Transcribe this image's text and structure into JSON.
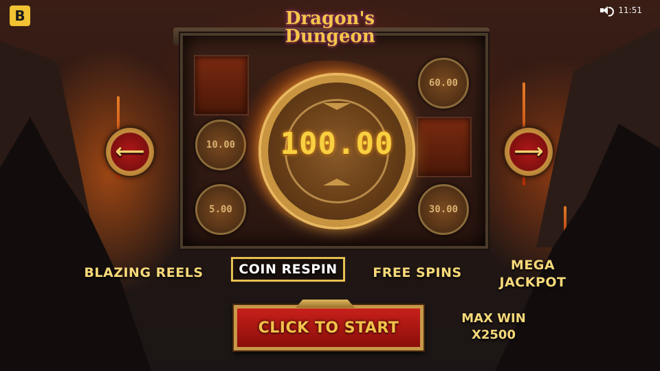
{
  "brand": {
    "logo_letter": "B"
  },
  "status_bar": {
    "time": "11:51",
    "sound_icon": "speaker-icon"
  },
  "game": {
    "title_line1": "Dragon's",
    "title_line2": "Dungeon"
  },
  "reels": {
    "big_coin_value": "100.00",
    "mini_coins": [
      {
        "value": "60.00"
      },
      {
        "value": "10.00"
      },
      {
        "value": "5.00"
      },
      {
        "value": "30.00"
      }
    ]
  },
  "navigation": {
    "prev_icon": "arrow-left-icon",
    "next_icon": "arrow-right-icon"
  },
  "features": [
    {
      "label": "BLAZING REELS",
      "active": false
    },
    {
      "label": "COIN RESPIN",
      "active": true
    },
    {
      "label": "FREE SPINS",
      "active": false
    },
    {
      "label": "MEGA JACKPOT",
      "active": false
    }
  ],
  "start_button": {
    "label": "CLICK TO START"
  },
  "max_win": {
    "line1": "MAX WIN",
    "line2": "X2500"
  },
  "colors": {
    "gold": "#f7d97a",
    "button_red": "#c8201a",
    "coin_gold": "#f8d040"
  }
}
